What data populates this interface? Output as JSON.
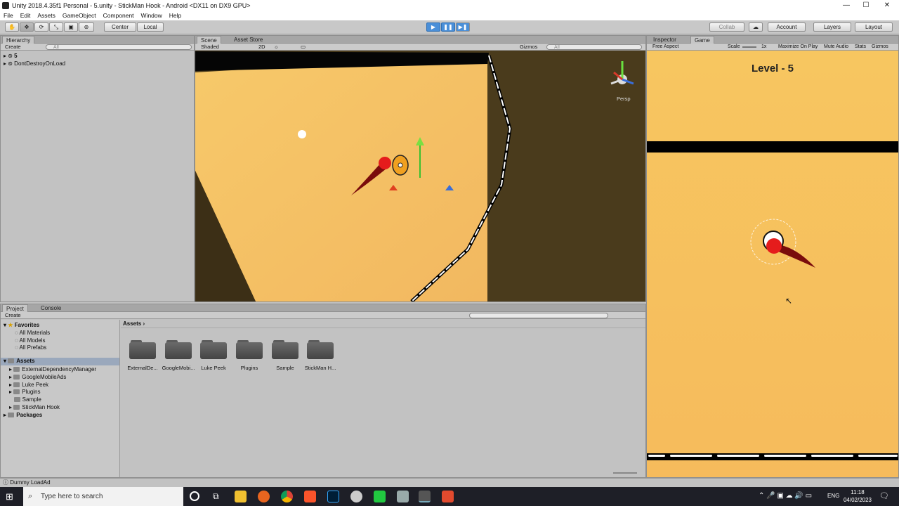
{
  "window": {
    "title": "Unity 2018.4.35f1 Personal - 5.unity - StickMan Hook - Android <DX11 on DX9 GPU>",
    "min": "—",
    "max": "☐",
    "close": "✕"
  },
  "menu": [
    "File",
    "Edit",
    "Assets",
    "GameObject",
    "Component",
    "Window",
    "Help"
  ],
  "toolbar": {
    "pivot": "Center",
    "space": "Local",
    "collab": "Collab",
    "account": "Account",
    "layers": "Layers",
    "layout": "Layout"
  },
  "hierarchy": {
    "tab": "Hierarchy",
    "create": "Create",
    "search_placeholder": "All",
    "items": [
      "5",
      "DontDestroyOnLoad"
    ]
  },
  "scene": {
    "tabs": [
      "Scene",
      "Asset Store"
    ],
    "shading": "Shaded",
    "mode2d": "2D",
    "gizmos": "Gizmos",
    "search_placeholder": "All",
    "persp": "Persp"
  },
  "game": {
    "tabs": [
      "Inspector",
      "Game"
    ],
    "aspect": "Free Aspect",
    "scale_label": "Scale",
    "scale_value": "1x",
    "maximize": "Maximize On Play",
    "mute": "Mute Audio",
    "stats": "Stats",
    "gizmos": "Gizmos",
    "level_text": "Level - 5"
  },
  "project": {
    "tabs": [
      "Project",
      "Console"
    ],
    "create": "Create",
    "breadcrumb": "Assets",
    "favorites_label": "Favorites",
    "favorites": [
      "All Materials",
      "All Models",
      "All Prefabs"
    ],
    "assets_label": "Assets",
    "asset_tree": [
      "ExternalDependencyManager",
      "GoogleMobileAds",
      "Luke Peek",
      "Plugins",
      "Sample",
      "StickMan Hook"
    ],
    "packages_label": "Packages",
    "folders": [
      "ExternalDe...",
      "GoogleMobi...",
      "Luke Peek",
      "Plugins",
      "Sample",
      "StickMan H..."
    ]
  },
  "status_bar": "Dummy LoadAd",
  "taskbar": {
    "search_placeholder": "Type here to search",
    "lang": "ENG",
    "time": "11:18",
    "date": "04/02/2023"
  },
  "colors": {
    "game_bg": "#f6c45e",
    "scene_floor": "#f4c264",
    "scene_void": "#4a3b1c",
    "ball": "#e51c1c",
    "tail": "#7a0c0c",
    "play_blue": "#4a8fd8"
  }
}
